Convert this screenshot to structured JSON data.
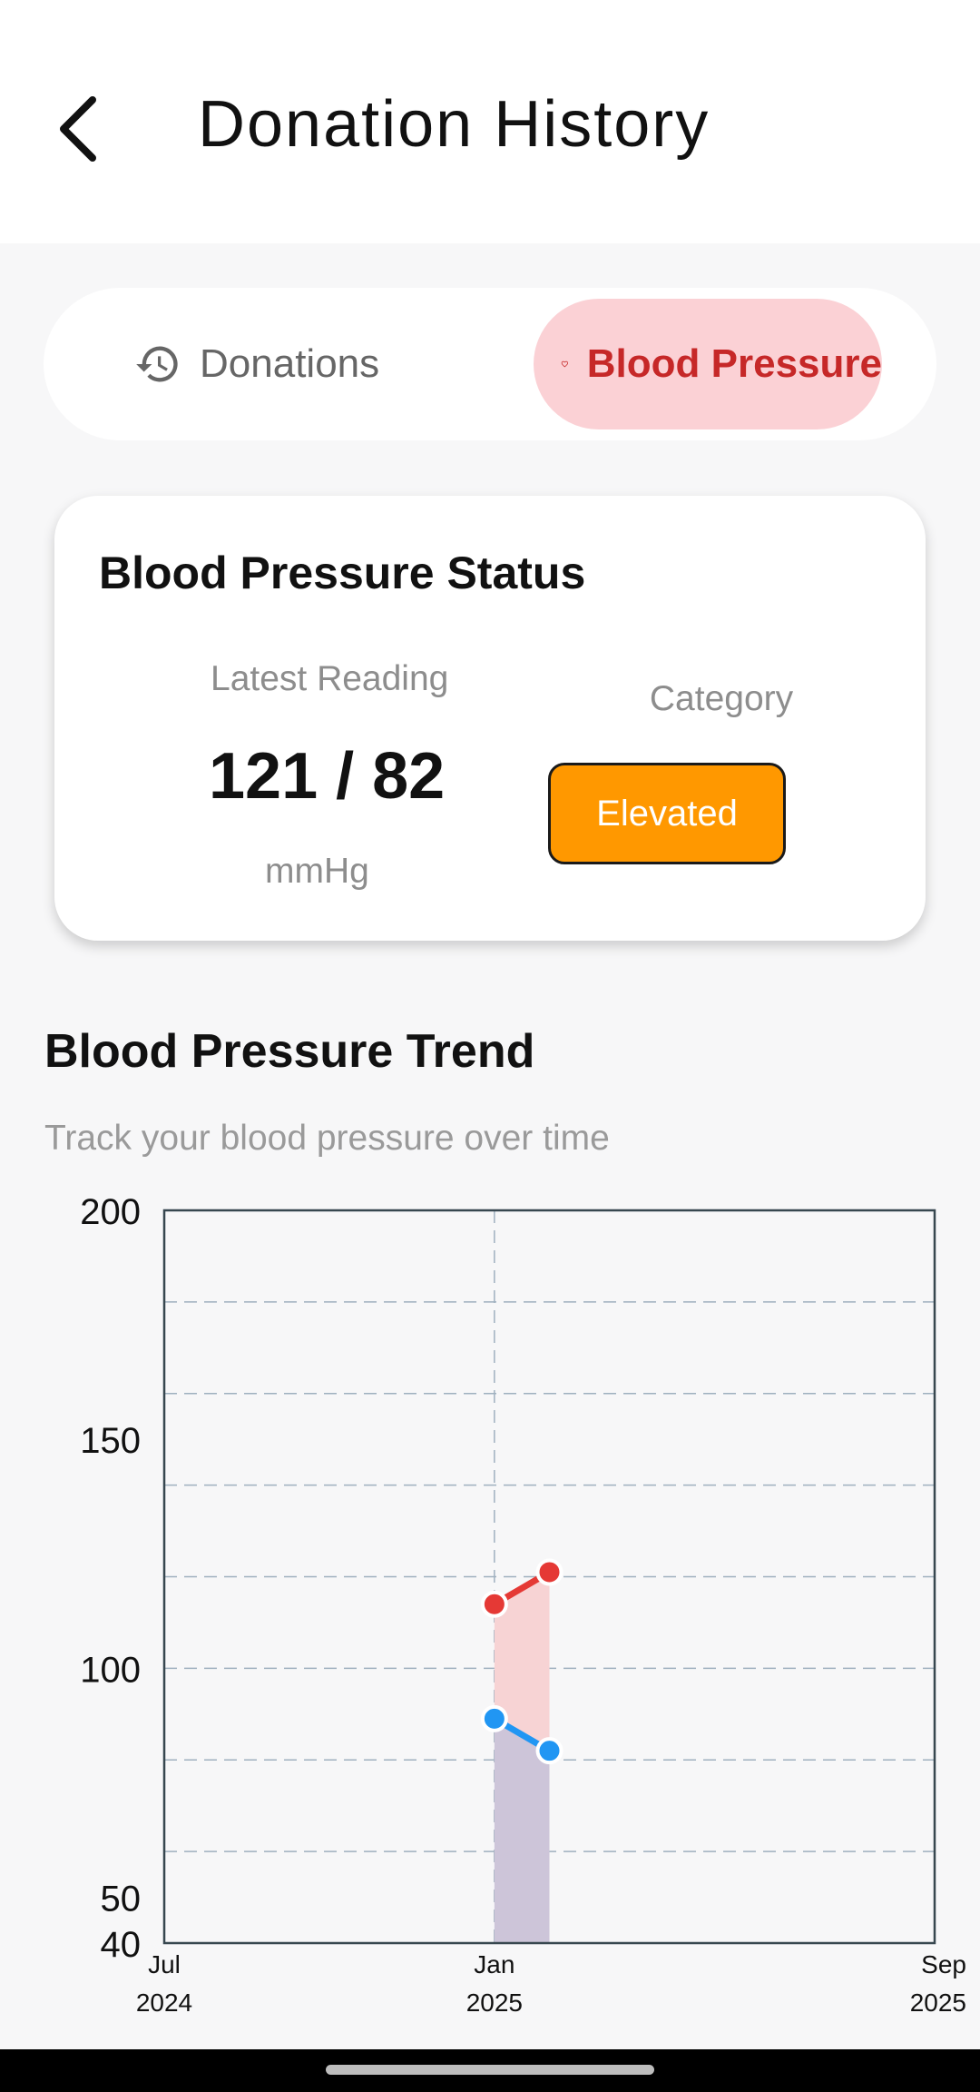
{
  "header": {
    "title": "Donation History",
    "back_icon": "chevron-left-icon"
  },
  "tabs": [
    {
      "label": "Donations",
      "icon": "history-icon",
      "selected": false
    },
    {
      "label": "Blood Pressure",
      "icon": "heart-outline-icon",
      "selected": true
    }
  ],
  "status_card": {
    "title": "Blood Pressure Status",
    "latest_label": "Latest Reading",
    "latest_value": "121 / 82",
    "unit": "mmHg",
    "category_label": "Category",
    "category_value": "Elevated",
    "category_color": "#ff9800"
  },
  "trend": {
    "title": "Blood Pressure Trend",
    "subtitle": "Track your blood pressure over time"
  },
  "colors": {
    "accent": "#c62828",
    "tab_selected_bg": "#fbd1d5",
    "systolic": "#e53935",
    "diastolic": "#2196f3"
  },
  "chart_data": {
    "type": "line",
    "title": "",
    "xlabel": "",
    "ylabel": "",
    "ylim": [
      40,
      200
    ],
    "yticks": [
      "200",
      "150",
      "100",
      "50",
      "40"
    ],
    "ytick_values": [
      200,
      150,
      100,
      50,
      40
    ],
    "xticks": [
      {
        "line1": "Jul",
        "line2": "2024",
        "value": "2024-07"
      },
      {
        "line1": "Jan",
        "line2": "2025",
        "value": "2025-01"
      },
      {
        "line1": "Sep",
        "line2": "2025",
        "value": "2025-09"
      }
    ],
    "xlim": [
      "2024-07",
      "2025-09"
    ],
    "grid": true,
    "series": [
      {
        "key": "systolic",
        "color": "#e53935",
        "x": [
          "2025-01",
          "2025-02"
        ],
        "values": [
          114,
          121
        ]
      },
      {
        "key": "diastolic",
        "color": "#2196f3",
        "x": [
          "2025-01",
          "2025-02"
        ],
        "values": [
          89,
          82
        ]
      }
    ]
  }
}
